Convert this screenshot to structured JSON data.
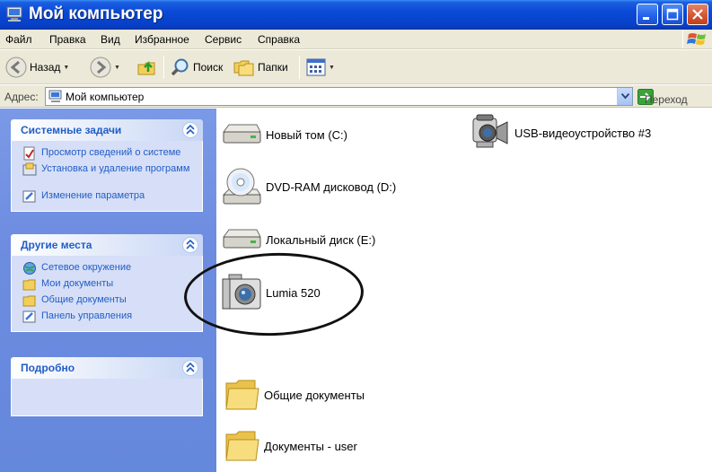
{
  "window": {
    "title": "Мой компьютер"
  },
  "menu": [
    "Файл",
    "Правка",
    "Вид",
    "Избранное",
    "Сервис",
    "Справка"
  ],
  "toolbar": {
    "back": "Назад",
    "search": "Поиск",
    "folders": "Папки"
  },
  "address": {
    "label": "Адрес:",
    "value": "Мой компьютер",
    "go": "Переход"
  },
  "left_panels": {
    "system_tasks": {
      "title": "Системные задачи",
      "items": [
        "Просмотр сведений о системе",
        "Установка и удаление программ",
        "Изменение параметра"
      ]
    },
    "other_places": {
      "title": "Другие места",
      "items": [
        "Сетевое окружение",
        "Мои документы",
        "Общие документы",
        "Панель управления"
      ]
    },
    "details": {
      "title": "Подробно"
    }
  },
  "items": {
    "drive_c": "Новый том (C:)",
    "drive_d": "DVD-RAM дисковод (D:)",
    "drive_e": "Локальный диск (E:)",
    "lumia": "Lumia 520",
    "usb_video": "USB-видеоустройство #3",
    "shared_docs": "Общие документы",
    "user_docs": "Документы - user"
  },
  "colors": {
    "title_bar": "#0a49d6",
    "left_pane": "#6d8ce0",
    "task_link": "#215dc6"
  }
}
